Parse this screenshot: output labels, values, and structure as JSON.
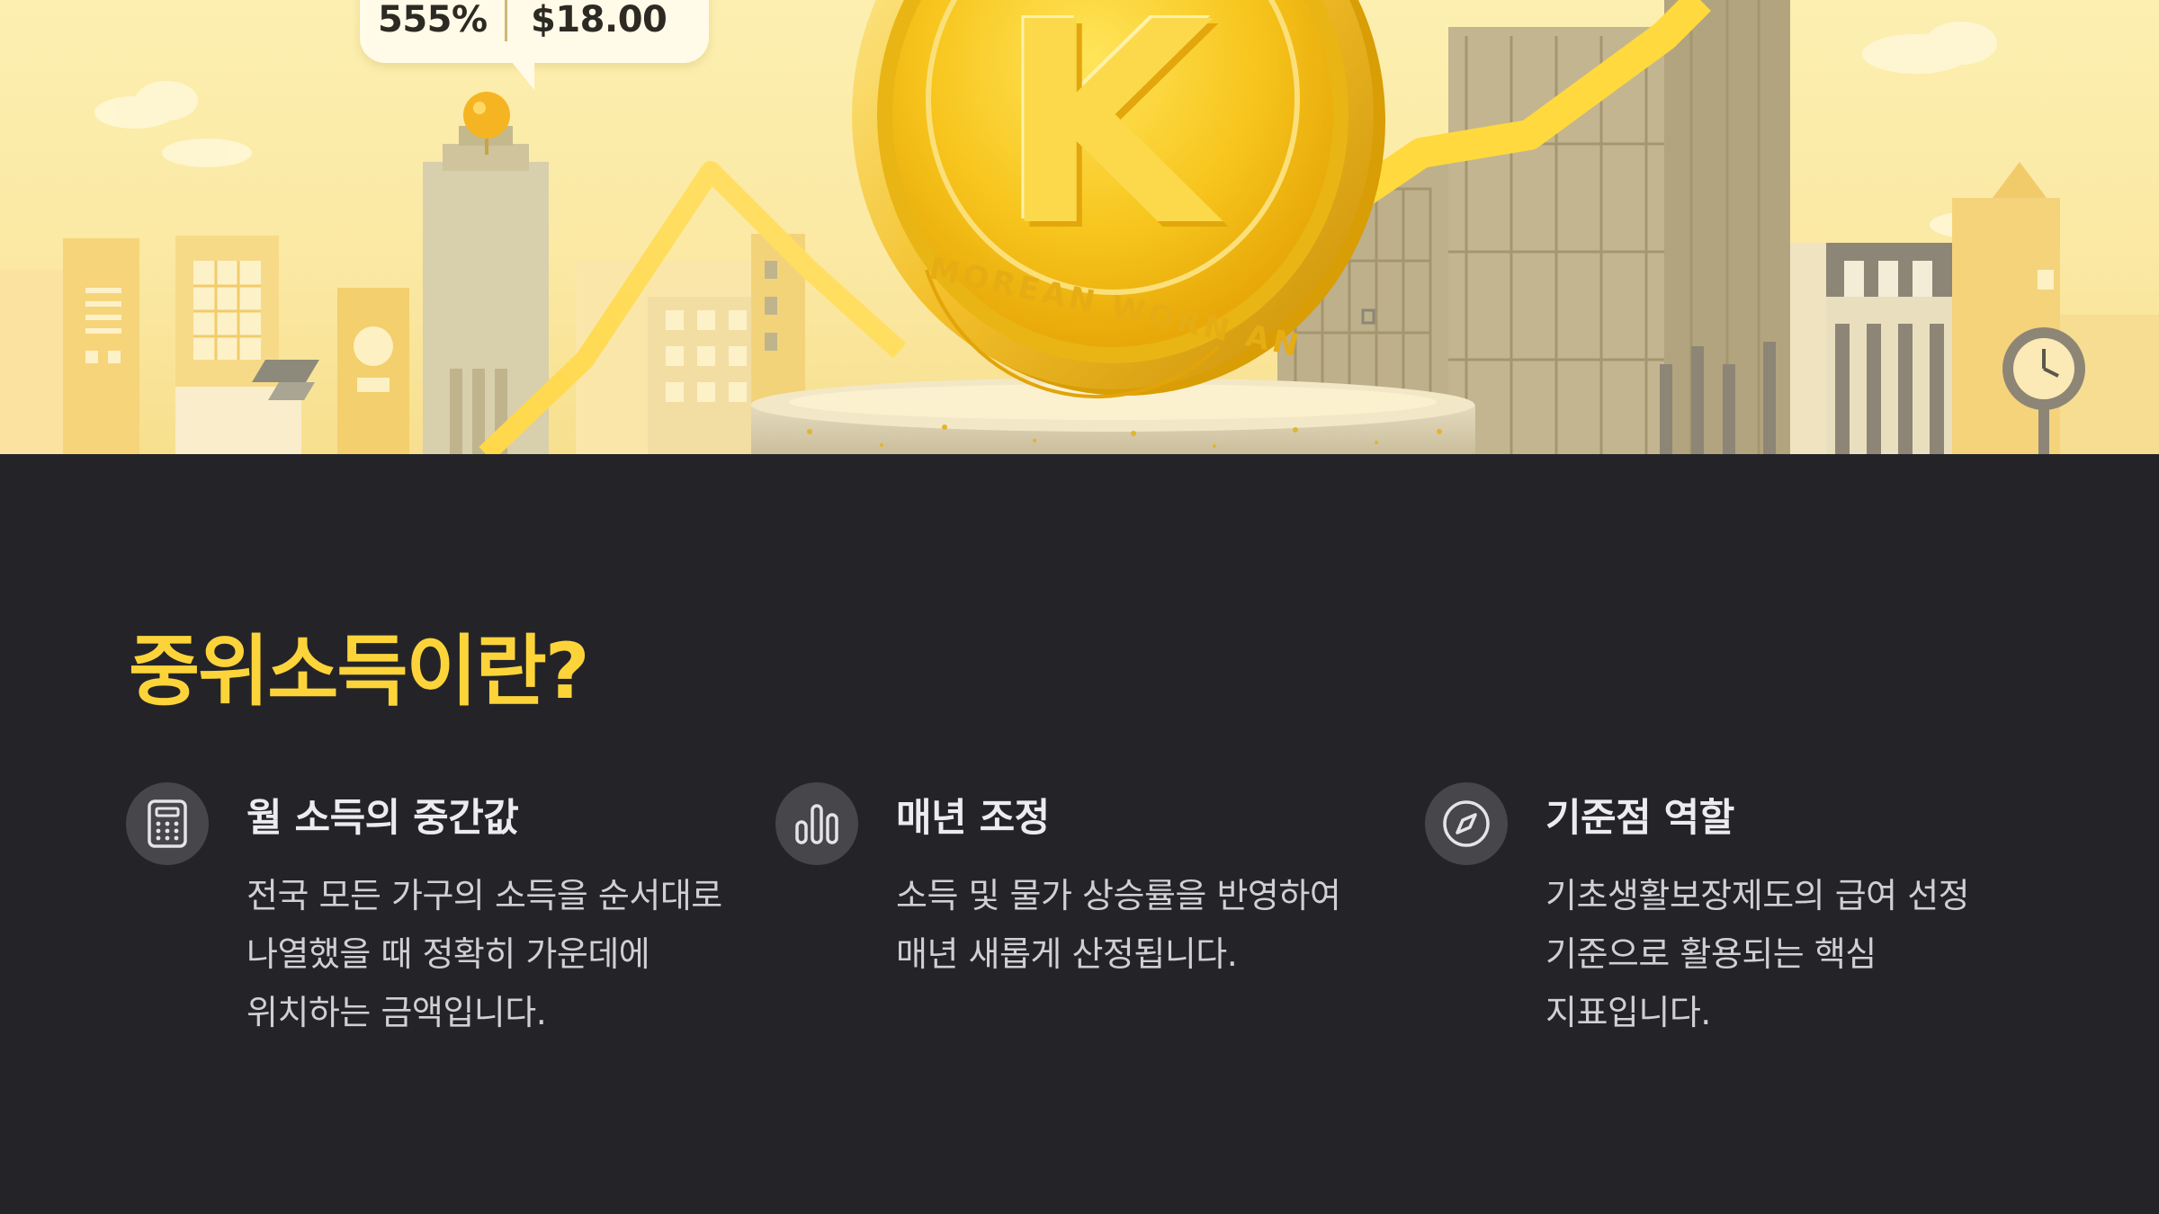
{
  "hero": {
    "price_percent": "555%",
    "price_usd": "$18.00",
    "coin_letter": "K",
    "coin_engraving": "MOREAN WORN AN"
  },
  "section": {
    "title": "중위소득이란?"
  },
  "features": [
    {
      "icon": "calculator-icon",
      "title": "월 소득의 중간값",
      "description": "전국 모든 가구의 소득을 순서대로 나열했을 때 정확히 가운데에 위치하는 금액입니다."
    },
    {
      "icon": "bar-chart-icon",
      "title": "매년 조정",
      "description": "소득 및 물가 상승률을 반영하여 매년 새롭게 산정됩니다."
    },
    {
      "icon": "compass-icon",
      "title": "기준점 역할",
      "description": "기초생활보장제도의 급여 선정 기준으로 활용되는 핵심 지표입니다."
    }
  ],
  "colors": {
    "background": "#242428",
    "title_accent": "#fcd43a",
    "icon_circle": "#46464b",
    "hero_yellow": "#fbe9a4",
    "coin_gold": "#f5c21c"
  }
}
